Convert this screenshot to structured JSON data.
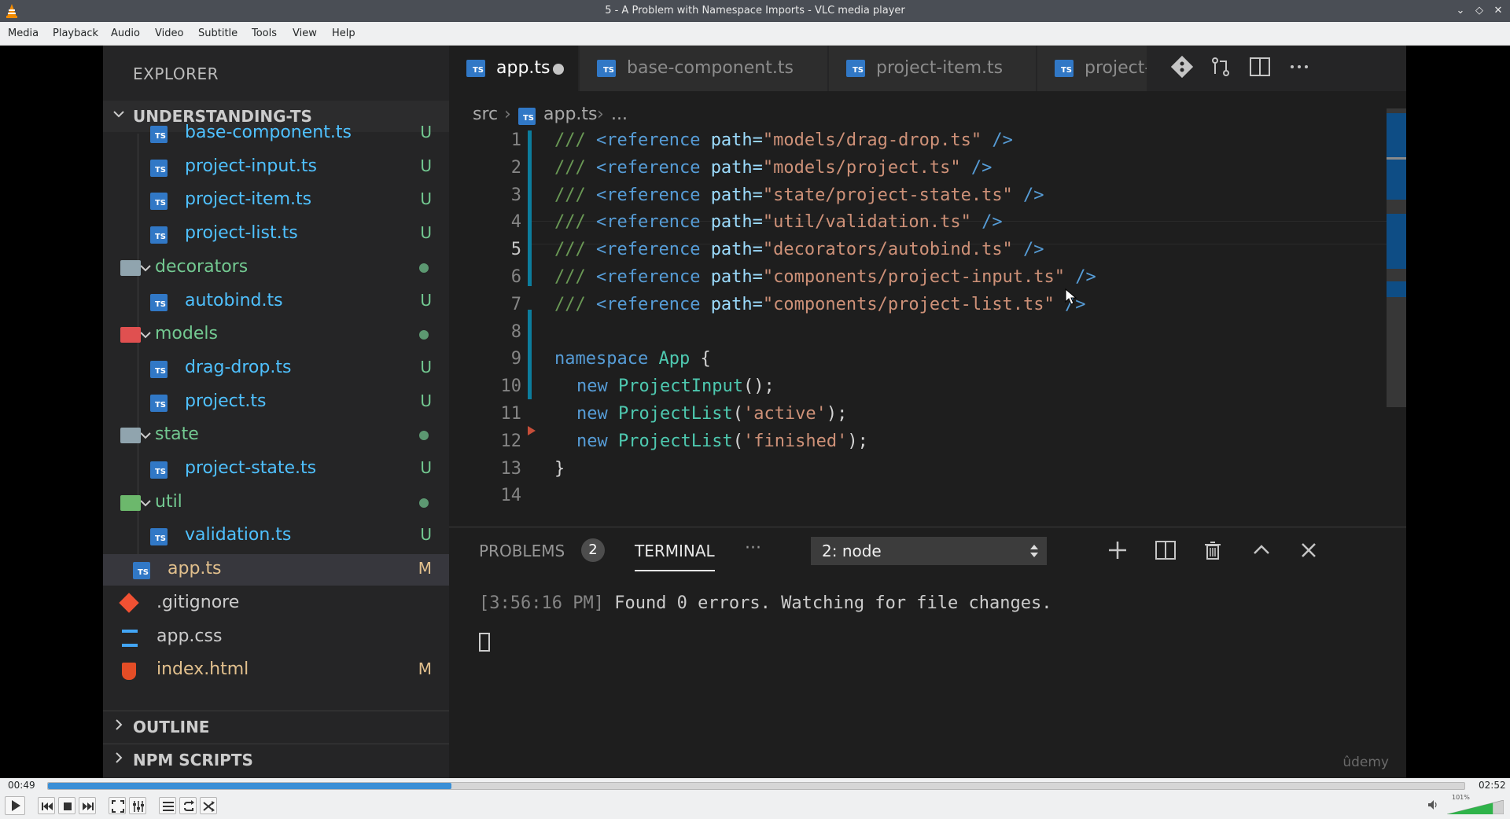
{
  "window": {
    "title": "5 - A Problem with Namespace Imports - VLC media player"
  },
  "menu": [
    "Media",
    "Playback",
    "Audio",
    "Video",
    "Subtitle",
    "Tools",
    "View",
    "Help"
  ],
  "explorer": {
    "title": "EXPLORER",
    "project": "UNDERSTANDING-TS",
    "rows": [
      {
        "name": "base-component.ts",
        "status": "U",
        "kind": "ts"
      },
      {
        "name": "project-input.ts",
        "status": "U",
        "kind": "ts"
      },
      {
        "name": "project-item.ts",
        "status": "U",
        "kind": "ts"
      },
      {
        "name": "project-list.ts",
        "status": "U",
        "kind": "ts"
      },
      {
        "name": "decorators",
        "status": "",
        "kind": "folder"
      },
      {
        "name": "autobind.ts",
        "status": "U",
        "kind": "ts"
      },
      {
        "name": "models",
        "status": "",
        "kind": "folder"
      },
      {
        "name": "drag-drop.ts",
        "status": "U",
        "kind": "ts"
      },
      {
        "name": "project.ts",
        "status": "U",
        "kind": "ts"
      },
      {
        "name": "state",
        "status": "",
        "kind": "folder"
      },
      {
        "name": "project-state.ts",
        "status": "U",
        "kind": "ts"
      },
      {
        "name": "util",
        "status": "",
        "kind": "folder"
      },
      {
        "name": "validation.ts",
        "status": "U",
        "kind": "ts"
      },
      {
        "name": "app.ts",
        "status": "M",
        "kind": "ts"
      },
      {
        "name": ".gitignore",
        "status": "",
        "kind": "git"
      },
      {
        "name": "app.css",
        "status": "",
        "kind": "css"
      },
      {
        "name": "index.html",
        "status": "M",
        "kind": "html"
      }
    ],
    "outline": "OUTLINE",
    "npm_scripts": "NPM SCRIPTS"
  },
  "tabs": [
    "app.ts",
    "base-component.ts",
    "project-item.ts",
    "project-li"
  ],
  "breadcrumb": {
    "folder": "src",
    "file": "app.ts",
    "more": "..."
  },
  "code": {
    "line_numbers": [
      "1",
      "2",
      "3",
      "4",
      "5",
      "6",
      "7",
      "8",
      "9",
      "10",
      "11",
      "12",
      "13",
      "14"
    ],
    "references": [
      "models/drag-drop.ts",
      "models/project.ts",
      "state/project-state.ts",
      "util/validation.ts",
      "decorators/autobind.ts",
      "components/project-input.ts",
      "components/project-list.ts"
    ],
    "ref_prefix": "/// ",
    "ref_tag": "<reference",
    "ref_attr": "path=",
    "ref_close": " />",
    "ns_keyword": "namespace",
    "ns_name": "App",
    "new_kw": "new",
    "class_input": "ProjectInput",
    "class_list": "ProjectList",
    "arg_active": "'active'",
    "arg_finished": "'finished'",
    "open_brace": " {",
    "close_brace": "}"
  },
  "panel": {
    "problems_label": "PROBLEMS",
    "problems_count": "2",
    "terminal_label": "TERMINAL",
    "more": "···",
    "terminal_select": "2: node",
    "timestamp": "[3:56:16 PM]",
    "message": "Found 0 errors. Watching for file changes.",
    "watermark": "ûdemy"
  },
  "player": {
    "elapsed": "00:49",
    "total": "02:52",
    "progress": 0.285,
    "volume_label": "101%",
    "volume": 1.01
  }
}
